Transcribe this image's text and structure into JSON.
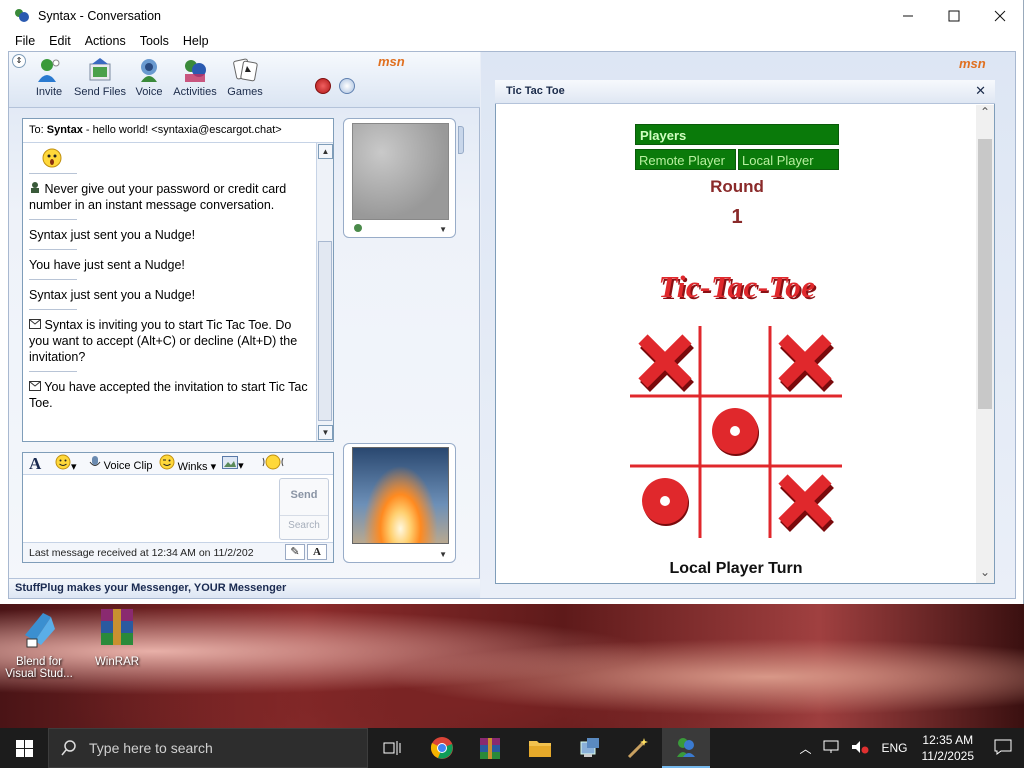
{
  "window": {
    "title": "Syntax - Conversation",
    "controls": [
      "minimize",
      "maximize",
      "close"
    ],
    "menu": [
      "File",
      "Edit",
      "Actions",
      "Tools",
      "Help"
    ]
  },
  "toolbar": {
    "buttons": [
      {
        "label": "Invite",
        "icon": "invite-icon"
      },
      {
        "label": "Send Files",
        "icon": "send-files-icon"
      },
      {
        "label": "Voice",
        "icon": "voice-icon"
      },
      {
        "label": "Activities",
        "icon": "activities-icon"
      },
      {
        "label": "Games",
        "icon": "games-icon"
      }
    ],
    "brand": "msn"
  },
  "conversation": {
    "to_prefix": "To:",
    "to_name": "Syntax",
    "to_status": " - hello world!  <syntaxia@escargot.chat>",
    "messages": [
      {
        "text": "Never give out your password or credit card number in an instant message conversation.",
        "icon": "security-icon"
      },
      {
        "text": "Syntax just sent you a Nudge!"
      },
      {
        "text": "You have just sent a Nudge!"
      },
      {
        "text": "Syntax just sent you a Nudge!"
      },
      {
        "text": "Syntax is inviting you to start Tic Tac Toe. Do you want to accept (Alt+C) or decline (Alt+D) the invitation?",
        "icon": "envelope-icon"
      },
      {
        "text": "You have accepted the invitation to start Tic Tac Toe.",
        "icon": "envelope-icon"
      }
    ]
  },
  "compose": {
    "voice_clip": "Voice Clip",
    "winks": "Winks",
    "send": "Send",
    "search": "Search",
    "status": "Last message received at 12:34 AM on 11/2/202"
  },
  "footer": "StuffPlug makes your Messenger, YOUR Messenger",
  "game": {
    "title": "Tic Tac Toe",
    "players_header": "Players",
    "remote_player": "Remote Player",
    "local_player": "Local Player",
    "round_label": "Round",
    "round_number": "1",
    "logo": "Tic-Tac-Toe",
    "board": [
      "X",
      "",
      "X",
      "",
      "O",
      "",
      "O",
      "",
      "X"
    ],
    "turn": "Local Player Turn",
    "colors": {
      "mark": "#e0282c",
      "player_bg": "#0a7a0a",
      "round": "#8a2a2a"
    }
  },
  "desktop": {
    "icons": [
      {
        "label": "Blend for Visual Stud..."
      },
      {
        "label": "WinRAR"
      }
    ]
  },
  "taskbar": {
    "search_placeholder": "Type here to search",
    "apps": [
      "task-view-icon",
      "chrome-icon",
      "winrar-icon",
      "file-explorer-icon",
      "network-app-icon",
      "magic-wand-icon",
      "msn-messenger-icon"
    ],
    "lang": "ENG",
    "time": "12:35 AM",
    "date": "11/2/2025"
  }
}
